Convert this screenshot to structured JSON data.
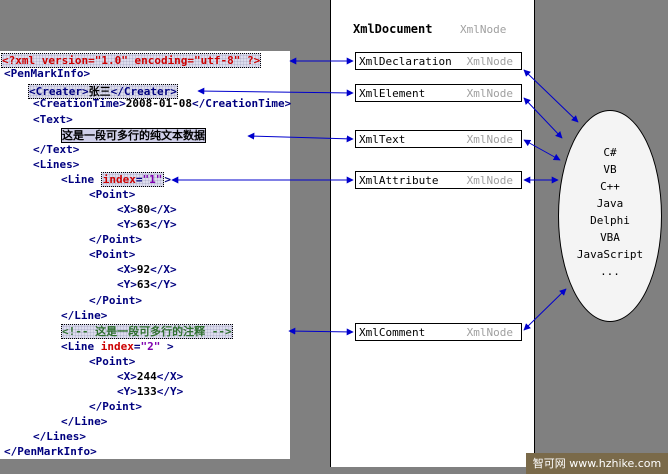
{
  "xml_lines": {
    "l0": {
      "decl": "<?xml version=\"1.0\" encoding=\"utf-8\" ?>"
    },
    "l1": {
      "text": "<PenMarkInfo>"
    },
    "l2": {
      "open": "<Creater>",
      "value": "张三",
      "close": "</Creater>"
    },
    "l3": {
      "open": "<CreationTime>",
      "value": "2008-01-08",
      "close": "</CreationTime>"
    },
    "l4": {
      "text": "<Text>"
    },
    "l5": {
      "value": "这是一段可多行的纯文本数据"
    },
    "l6": {
      "text": "</Text>"
    },
    "l7": {
      "text": "<Lines>"
    },
    "l8": {
      "open": "<Line ",
      "attr": "index",
      "eq": "=",
      "val": "\"1\"",
      "close": ">"
    },
    "l9": {
      "text": "<Point>"
    },
    "l10": {
      "open": "<X>",
      "value": "80",
      "close": "</X>"
    },
    "l11": {
      "open": "<Y>",
      "value": "63",
      "close": "</Y>"
    },
    "l12": {
      "text": "</Point>"
    },
    "l13": {
      "text": "<Point>"
    },
    "l14": {
      "open": "<X>",
      "value": "92",
      "close": "</X>"
    },
    "l15": {
      "open": "<Y>",
      "value": "63",
      "close": "</Y>"
    },
    "l16": {
      "text": "</Point>"
    },
    "l17": {
      "text": "</Line>"
    },
    "l18": {
      "comment": "<!-- 这是一段可多行的注释 -->"
    },
    "l19": {
      "open": "<Line ",
      "attr": "index",
      "eq": "=",
      "val": "\"2\"",
      "close": " >"
    },
    "l20": {
      "text": "<Point>"
    },
    "l21": {
      "open": "<X>",
      "value": "244",
      "close": "</X>"
    },
    "l22": {
      "open": "<Y>",
      "value": "133",
      "close": "</Y>"
    },
    "l23": {
      "text": "</Point>"
    },
    "l24": {
      "text": "</Line>"
    },
    "l25": {
      "text": "</Lines>"
    },
    "l26": {
      "text": "</PenMarkInfo>"
    }
  },
  "nodes": {
    "header": {
      "name": "XmlDocument",
      "type": "XmlNode"
    },
    "declaration": {
      "name": "XmlDeclaration",
      "type": "XmlNode"
    },
    "element": {
      "name": "XmlElement",
      "type": "XmlNode"
    },
    "text": {
      "name": "XmlText",
      "type": "XmlNode"
    },
    "attribute": {
      "name": "XmlAttribute",
      "type": "XmlNode"
    },
    "comment": {
      "name": "XmlComment",
      "type": "XmlNode"
    }
  },
  "languages": [
    "C#",
    "VB",
    "C++",
    "Java",
    "Delphi",
    "VBA",
    "JavaScript",
    "..."
  ],
  "watermark": "智可网 www.hzhike.com",
  "colors": {
    "tag": "#00007f",
    "attr": "#cc0000",
    "value": "#7f00b0",
    "arrow": "#0000cc"
  }
}
